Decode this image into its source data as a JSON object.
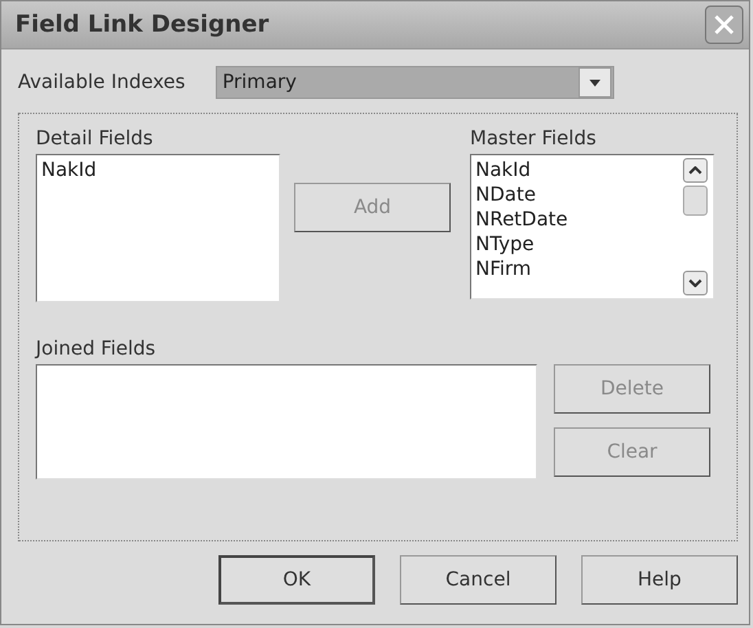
{
  "window": {
    "title": "Field Link Designer"
  },
  "indexes": {
    "label": "Available Indexes",
    "value": "Primary"
  },
  "detail_fields": {
    "label": "Detail Fields",
    "items": [
      {
        "text": "NakId",
        "selected": false
      }
    ]
  },
  "add_button": {
    "label": "Add",
    "disabled": true
  },
  "master_fields": {
    "label": "Master Fields",
    "items": [
      {
        "text": "NakId",
        "selected": false
      },
      {
        "text": "NDate",
        "selected": false
      },
      {
        "text": "NRetDate",
        "selected": false
      },
      {
        "text": "NType",
        "selected": false
      },
      {
        "text": "NFirm",
        "selected": false
      }
    ]
  },
  "joined_fields": {
    "label": "Joined Fields"
  },
  "side_buttons": [
    {
      "label": "Delete",
      "disabled": true
    },
    {
      "label": "Clear",
      "disabled": true
    }
  ],
  "buttons": [
    {
      "label": "OK",
      "default": true,
      "disabled": false
    },
    {
      "label": "Cancel",
      "default": false,
      "disabled": false
    },
    {
      "label": "Help",
      "default": false,
      "disabled": false
    }
  ]
}
